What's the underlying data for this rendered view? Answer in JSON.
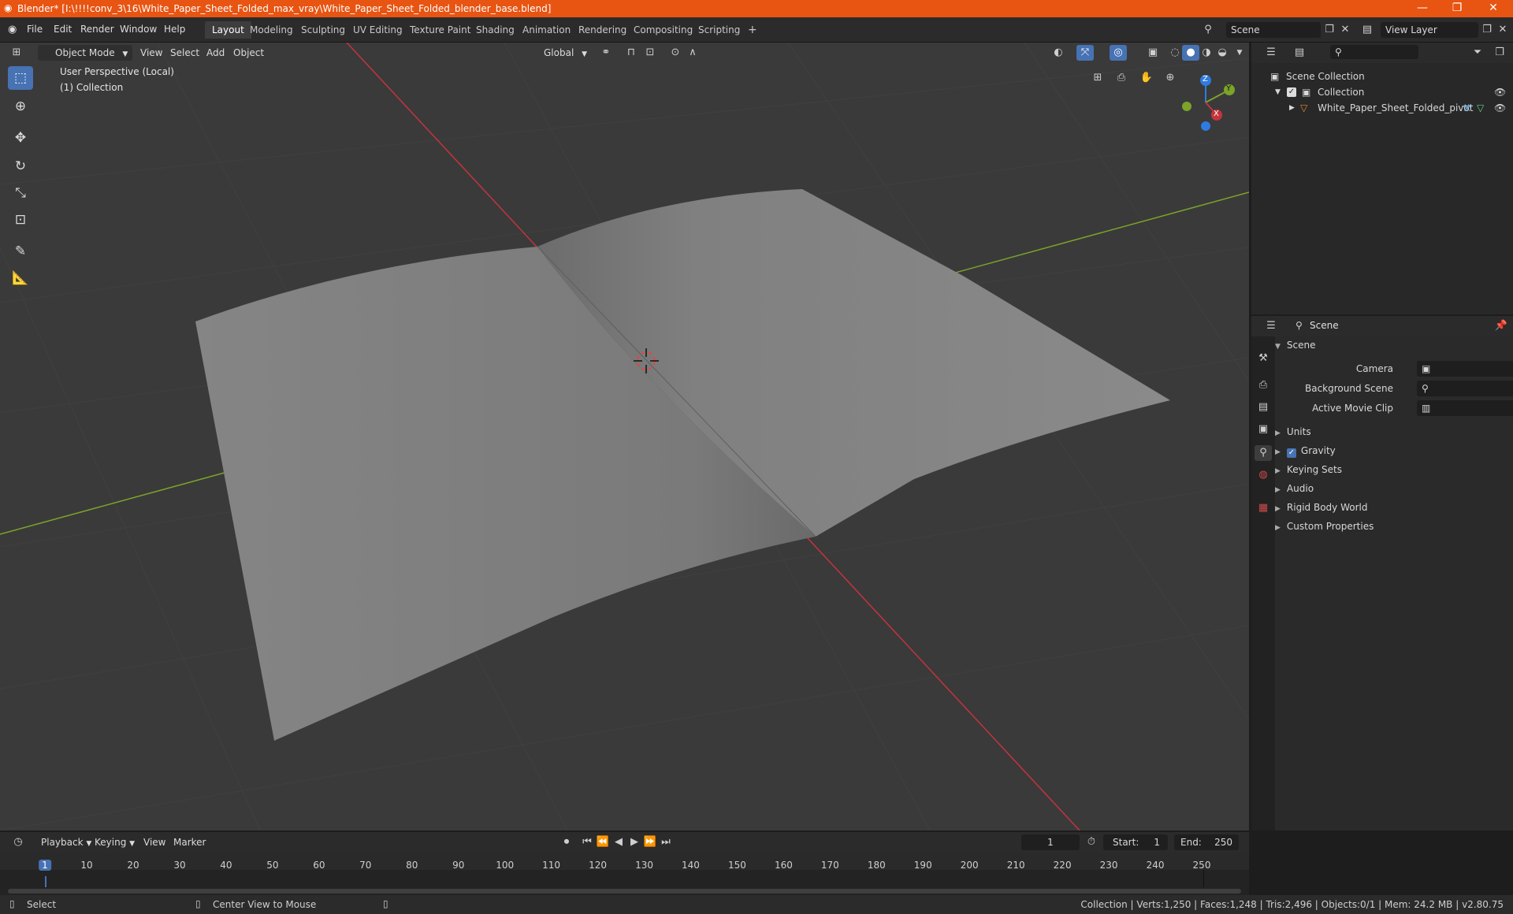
{
  "titlebar": {
    "title": "Blender* [I:\\!!!!conv_3\\16\\White_Paper_Sheet_Folded_max_vray\\White_Paper_Sheet_Folded_blender_base.blend]",
    "minimize": "—",
    "restore": "❐",
    "close": "✕"
  },
  "menu": {
    "items": [
      "File",
      "Edit",
      "Render",
      "Window",
      "Help"
    ]
  },
  "workspaces": [
    "Layout",
    "Modeling",
    "Sculpting",
    "UV Editing",
    "Texture Paint",
    "Shading",
    "Animation",
    "Rendering",
    "Compositing",
    "Scripting"
  ],
  "workspace_add": "+",
  "scene_field": "Scene",
  "viewlayer_field": "View Layer",
  "viewport": {
    "mode": "Object Mode",
    "menus": [
      "View",
      "Select",
      "Add",
      "Object"
    ],
    "orientation": "Global",
    "perspective": "User Perspective (Local)",
    "collection": "(1) Collection",
    "gizmo": {
      "z": "Z",
      "y": "Y",
      "x": "X"
    }
  },
  "outliner": {
    "root": "Scene Collection",
    "collection": "Collection",
    "object": "White_Paper_Sheet_Folded_pivot"
  },
  "properties": {
    "context": "Scene",
    "panel": "Scene",
    "fields": [
      {
        "label": "Camera"
      },
      {
        "label": "Background Scene"
      },
      {
        "label": "Active Movie Clip"
      }
    ],
    "sections": [
      "Units",
      "Gravity",
      "Keying Sets",
      "Audio",
      "Rigid Body World",
      "Custom Properties"
    ]
  },
  "timeline": {
    "menus": [
      "Playback",
      "Keying",
      "View",
      "Marker"
    ],
    "current_frame": "1",
    "start_label": "Start:",
    "start": "1",
    "end_label": "End:",
    "end": "250",
    "ticks": [
      "1",
      "10",
      "20",
      "30",
      "40",
      "50",
      "60",
      "70",
      "80",
      "90",
      "100",
      "110",
      "120",
      "130",
      "140",
      "150",
      "160",
      "170",
      "180",
      "190",
      "200",
      "210",
      "220",
      "230",
      "240",
      "250"
    ]
  },
  "statusbar": {
    "select": "Select",
    "center": "Center View to Mouse",
    "info": "Collection | Verts:1,250 | Faces:1,248 | Tris:2,496 | Objects:0/1 | Mem: 24.2 MB | v2.80.75"
  },
  "colors": {
    "titlebar": "#e85412",
    "accent": "#4772b3",
    "x_axis": "#c4343c",
    "y_axis": "#7ca32a",
    "z_axis": "#2f7be0"
  }
}
